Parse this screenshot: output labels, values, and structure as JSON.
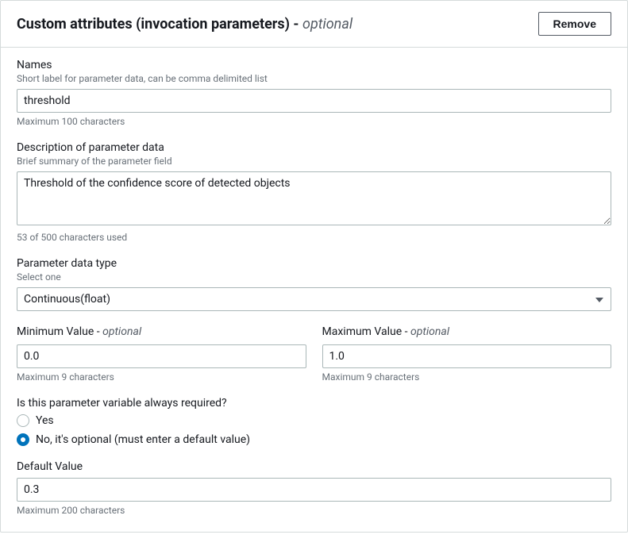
{
  "header": {
    "title_main": "Custom attributes (invocation parameters)",
    "title_sep": " - ",
    "title_optional": "optional",
    "remove_label": "Remove"
  },
  "names": {
    "label": "Names",
    "sublabel": "Short label for parameter data, can be comma delimited list",
    "value": "threshold",
    "hint": "Maximum 100 characters"
  },
  "description": {
    "label": "Description of parameter data",
    "sublabel": "Brief summary of the parameter field",
    "value": "Threshold of the confidence score of detected objects",
    "hint": "53 of 500 characters used"
  },
  "datatype": {
    "label": "Parameter data type",
    "sublabel": "Select one",
    "value": "Continuous(float)"
  },
  "minvalue": {
    "label_main": "Minimum Value",
    "label_sep": " - ",
    "label_optional": "optional",
    "value": "0.0",
    "hint": "Maximum 9 characters"
  },
  "maxvalue": {
    "label_main": "Maximum Value",
    "label_sep": " - ",
    "label_optional": "optional",
    "value": "1.0",
    "hint": "Maximum 9 characters"
  },
  "required": {
    "label": "Is this parameter variable always required?",
    "option_yes": "Yes",
    "option_no": "No, it's optional (must enter a default value)",
    "selected": "no"
  },
  "defaultvalue": {
    "label": "Default Value",
    "value": "0.3",
    "hint": "Maximum 200 characters"
  }
}
